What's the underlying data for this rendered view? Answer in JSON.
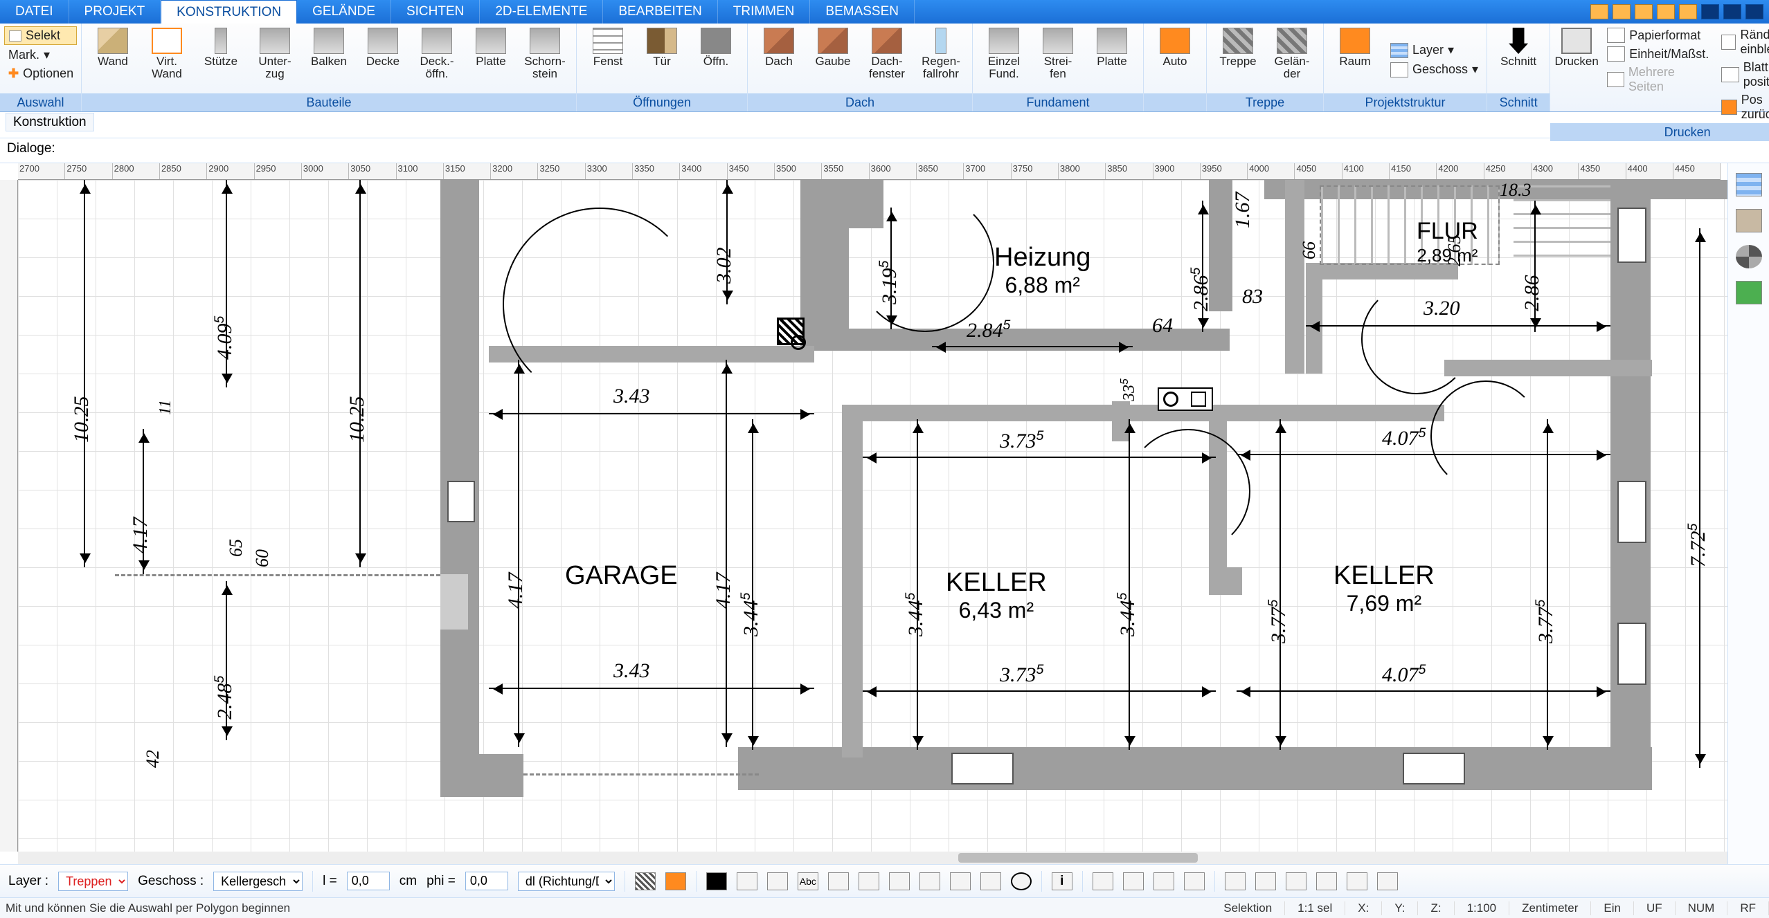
{
  "tabs": [
    "DATEI",
    "PROJEKT",
    "KONSTRUKTION",
    "GELÄNDE",
    "SICHTEN",
    "2D-ELEMENTE",
    "BEARBEITEN",
    "TRIMMEN",
    "BEMASSEN"
  ],
  "active_tab": 2,
  "ribbon": {
    "auswahl": {
      "label": "Auswahl",
      "selekt": "Selekt",
      "mark": "Mark.",
      "optionen": "Optionen"
    },
    "bauteile": {
      "label": "Bauteile",
      "items": [
        "Wand",
        "Virt.\nWand",
        "Stütze",
        "Unter-\nzug",
        "Balken",
        "Decke",
        "Deck.-\nöffn.",
        "Platte",
        "Schorn-\nstein"
      ]
    },
    "oeff": {
      "label": "Öffnungen",
      "items": [
        "Fenst",
        "Tür",
        "Öffn."
      ]
    },
    "dach": {
      "label": "Dach",
      "items": [
        "Dach",
        "Gaube",
        "Dach-\nfenster",
        "Regen-\nfallrohr"
      ]
    },
    "fund": {
      "label": "Fundament",
      "items": [
        "Einzel\nFund.",
        "Strei-\nfen",
        "Platte"
      ]
    },
    "auto": {
      "label": "",
      "btn": "Auto"
    },
    "treppe": {
      "label": "Treppe",
      "items": [
        "Treppe",
        "Gelän-\nder"
      ]
    },
    "proj": {
      "label": "Projektstruktur",
      "raum": "Raum",
      "layer": "Layer",
      "geschoss": "Geschoss"
    },
    "schnitt": {
      "label": "Schnitt",
      "btn": "Schnitt"
    },
    "drucken": {
      "label": "Drucken",
      "btn": "Drucken",
      "opts": [
        "Papierformat",
        "Einheit/Maßst.",
        "Mehrere Seiten",
        "Ränder einblend.",
        "Blatt position.",
        "Pos zurücksetz."
      ]
    }
  },
  "panel": {
    "kon": "Konstruktion",
    "dlg": "Dialoge:"
  },
  "ruler_h": [
    "2700",
    "2750",
    "2800",
    "2850",
    "2900",
    "2950",
    "3000",
    "3050",
    "3100",
    "3150",
    "3200",
    "3250",
    "3300",
    "3350",
    "3400",
    "3450",
    "3500",
    "3550",
    "3600",
    "3650",
    "3700",
    "3750",
    "3800",
    "3850",
    "3900",
    "3950",
    "4000",
    "4050",
    "4100",
    "4150",
    "4200",
    "4250",
    "4300",
    "4350",
    "4400",
    "4450"
  ],
  "rooms": {
    "garage": {
      "name": "GARAGE"
    },
    "heizung": {
      "name": "Heizung",
      "area": "6,88 m²"
    },
    "flur": {
      "name": "FLUR",
      "area": "2,89 m²"
    },
    "keller1": {
      "name": "KELLER",
      "area": "6,43 m²"
    },
    "keller2": {
      "name": "KELLER",
      "area": "7,69 m²"
    }
  },
  "dims": {
    "d343a": "3.43",
    "d343b": "3.43",
    "d373a": "3.73⁵",
    "d373b": "3.73⁵",
    "d407a": "4.07⁵",
    "d407b": "4.07⁵",
    "d284": "2.84⁵",
    "d320": "3.20",
    "d302": "3.02",
    "d319": "3.19⁵",
    "d286a": "2.86⁵",
    "d286b": "2.86",
    "d167": "1.67",
    "d183": "18.3",
    "d66": "66",
    "d83": "83",
    "d64": "64",
    "d33": "33⁵",
    "d772": "7.72⁵",
    "d1025a": "10.25",
    "d1025b": "10.25",
    "d409": "4.09⁵",
    "d417a": "4.17",
    "d417b": "4.17",
    "d417c": "4.17",
    "d248": "2.48⁵",
    "d42": "42",
    "d65": "65",
    "d60": "60",
    "d11": "11",
    "d344a": "3.44⁵",
    "d344b": "3.44⁵",
    "d377a": "3.77⁵",
    "d377b": "3.77⁵",
    "d265": "2.65"
  },
  "bbar": {
    "layer_lbl": "Layer :",
    "layer_val": "Treppen",
    "geschoss_lbl": "Geschoss :",
    "geschoss_val": "Kellergesch",
    "l_lbl": "l =",
    "l_val": "0,0",
    "l_unit": "cm",
    "phi_lbl": "phi =",
    "phi_val": "0,0",
    "mode": "dl (Richtung/Di"
  },
  "status": {
    "msg": "Mit <Umschalt> und <Strg> können Sie die Auswahl per Polygon beginnen",
    "sel": "Selektion",
    "ratio": "1:1 sel",
    "x": "X:",
    "y": "Y:",
    "z": "Z:",
    "scale": "1:100",
    "unit": "Zentimeter",
    "ein": "Ein",
    "uf": "UF",
    "num": "NUM",
    "rf": "RF"
  }
}
